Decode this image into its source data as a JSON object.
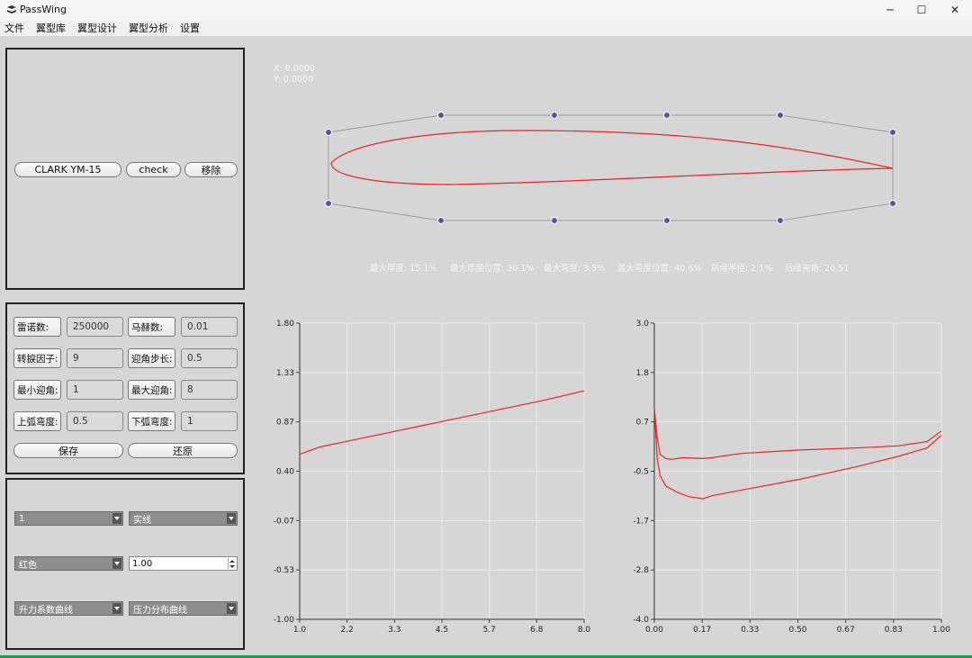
{
  "window": {
    "title": "PassWing",
    "minimize": "─",
    "maximize": "☐",
    "close": "✕"
  },
  "menu": [
    "文件",
    "翼型库",
    "翼型设计",
    "翼型分析",
    "设置"
  ],
  "airfoil_panel": {
    "name_button": "CLARK YM-15",
    "check_button": "check",
    "remove_button": "移除"
  },
  "params": {
    "reynolds_label": "雷诺数:",
    "reynolds_value": "250000",
    "mach_label": "马赫数:",
    "mach_value": "0.01",
    "transition_label": "转捩因子:",
    "transition_value": "9",
    "aoa_step_label": "迎角步长:",
    "aoa_step_value": "0.5",
    "min_aoa_label": "最小迎角:",
    "min_aoa_value": "1",
    "max_aoa_label": "最大迎角:",
    "max_aoa_value": "8",
    "upper_curv_label": "上弧弯度:",
    "upper_curv_value": "0.5",
    "lower_curv_label": "下弧弯度:",
    "lower_curv_value": "1",
    "save_button": "保存",
    "restore_button": "还原"
  },
  "style_panel": {
    "width_select": "1",
    "line_style_select": "实线",
    "color_select": "红色",
    "scale_value": "1.00",
    "left_curve_select": "升力系数曲线",
    "right_curve_select": "压力分布曲线"
  },
  "canvas": {
    "x_readout": "X: 0.0000",
    "y_readout": "Y: 0.0000",
    "stats": {
      "max_thickness": "最大厚度: 15.1%",
      "max_thickness_pos": "最大厚度位置: 30.1%",
      "max_camber": "最大弯度: 3.5%",
      "max_camber_pos": "最大弯度位置: 40.6%",
      "le_radius": "前缘半径: 2.1%",
      "te_angle": "后缘夹角: 20.51"
    }
  },
  "colors": {
    "curve": "#ee2222",
    "control_point": "#5b4fa8",
    "control_line": "#9a9a9a",
    "grid": "#ececec",
    "accent_green": "#1e9c4e"
  },
  "chart_data": [
    {
      "type": "line",
      "title": "",
      "xlabel": "",
      "ylabel": "",
      "x_ticks": [
        "1.0",
        "2.2",
        "3.3",
        "4.5",
        "5.7",
        "6.8",
        "8.0"
      ],
      "y_ticks": [
        "1.80",
        "1.33",
        "0.87",
        "0.40",
        "-0.07",
        "-0.53",
        "-1.00"
      ],
      "xlim": [
        1.0,
        8.0
      ],
      "ylim": [
        -1.0,
        1.8
      ],
      "grid": true,
      "series": [
        {
          "x": [
            1.0,
            1.5,
            2.0,
            3.0,
            4.0,
            5.0,
            6.0,
            7.0,
            8.0
          ],
          "y": [
            0.56,
            0.63,
            0.67,
            0.75,
            0.83,
            0.91,
            0.99,
            1.07,
            1.16
          ]
        }
      ]
    },
    {
      "type": "line",
      "title": "",
      "xlabel": "",
      "ylabel": "",
      "x_ticks": [
        "0.00",
        "0.17",
        "0.33",
        "0.50",
        "0.67",
        "0.83",
        "1.00"
      ],
      "y_ticks": [
        "3.0",
        "1.8",
        "0.7",
        "-0.5",
        "-1.7",
        "-2.8",
        "-4.0"
      ],
      "xlim": [
        0.0,
        1.0
      ],
      "ylim": [
        -4.0,
        3.0
      ],
      "grid": true,
      "series": [
        {
          "x": [
            0.0,
            0.01,
            0.02,
            0.04,
            0.06,
            0.1,
            0.17,
            0.2,
            0.3,
            0.5,
            0.7,
            0.85,
            0.95,
            1.0
          ],
          "y": [
            1.0,
            0.3,
            -0.1,
            -0.2,
            -0.22,
            -0.18,
            -0.2,
            -0.18,
            -0.08,
            0.0,
            0.05,
            0.1,
            0.2,
            0.45
          ]
        },
        {
          "x": [
            0.0,
            0.01,
            0.02,
            0.04,
            0.08,
            0.12,
            0.17,
            0.2,
            0.3,
            0.5,
            0.7,
            0.85,
            0.95,
            1.0
          ],
          "y": [
            1.0,
            -0.2,
            -0.6,
            -0.85,
            -1.0,
            -1.1,
            -1.15,
            -1.08,
            -0.95,
            -0.7,
            -0.4,
            -0.15,
            0.05,
            0.35
          ]
        }
      ]
    }
  ]
}
